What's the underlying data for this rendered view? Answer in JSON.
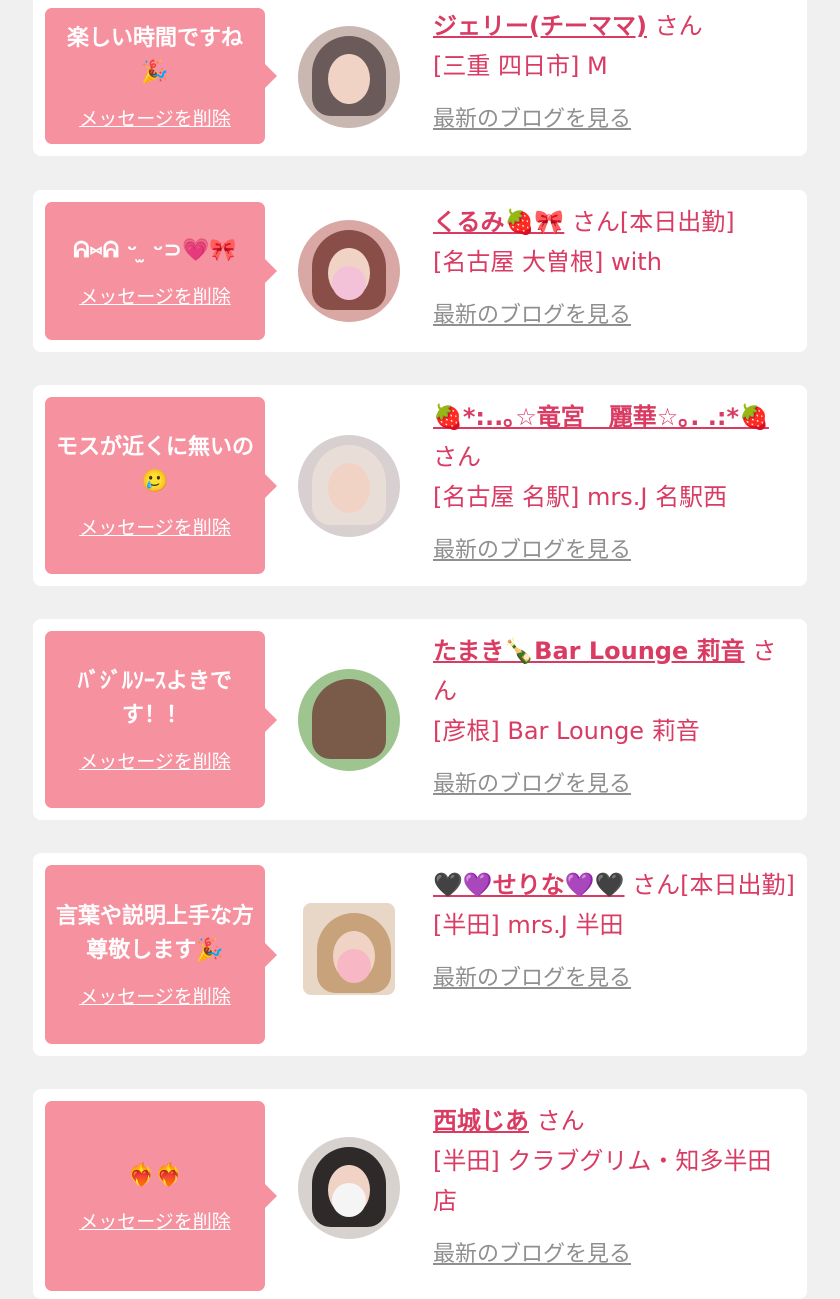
{
  "labels": {
    "delete": "メッセージを削除",
    "blog": "最新のブログを見る"
  },
  "colors": {
    "page_bg": "#f0f0f0",
    "card_bg": "#ffffff",
    "bubble_bg": "#f6919f",
    "accent": "#d93b63",
    "blog_link": "#8f8f8f"
  },
  "cards": [
    {
      "message": "楽しい時間ですね 🎉",
      "name": "ジェリー(チーママ)",
      "suffix": " さん",
      "location": "[三重 四日市] M",
      "avatar_icon": "avatar-photo"
    },
    {
      "message": "ᕱ⑅ᕱ ᵕ ̫ ᵕ⊃💗🎀",
      "name": "くるみ🍓🎀",
      "suffix": " さん[本日出勤]",
      "location": "[名古屋 大曽根] with",
      "avatar_icon": "avatar-photo"
    },
    {
      "message": "モスが近くに無いの🥲",
      "name": "🍓*:..｡☆竜宮　麗華☆｡. .:*🍓",
      "suffix": " さん",
      "location": "[名古屋 名駅] mrs.J 名駅西",
      "avatar_icon": "avatar-photo"
    },
    {
      "message": "ﾊﾞｼﾞﾙｿｰｽよきです！！",
      "name": "たまき🍾Bar Lounge 莉音",
      "suffix": " さん",
      "location": "[彦根] Bar Lounge 莉音",
      "avatar_icon": "avatar-photo"
    },
    {
      "message": "言葉や説明上手な方尊敬します🎉",
      "name": "🖤💜せりな💜🖤",
      "suffix": " さん[本日出勤]",
      "location": "[半田] mrs.J 半田",
      "avatar_icon": "avatar-photo"
    },
    {
      "message": "❤️‍🔥❤️‍🔥",
      "name": "西城じあ",
      "suffix": " さん",
      "location": "[半田] クラブグリム・知多半田店",
      "avatar_icon": "avatar-photo"
    }
  ]
}
